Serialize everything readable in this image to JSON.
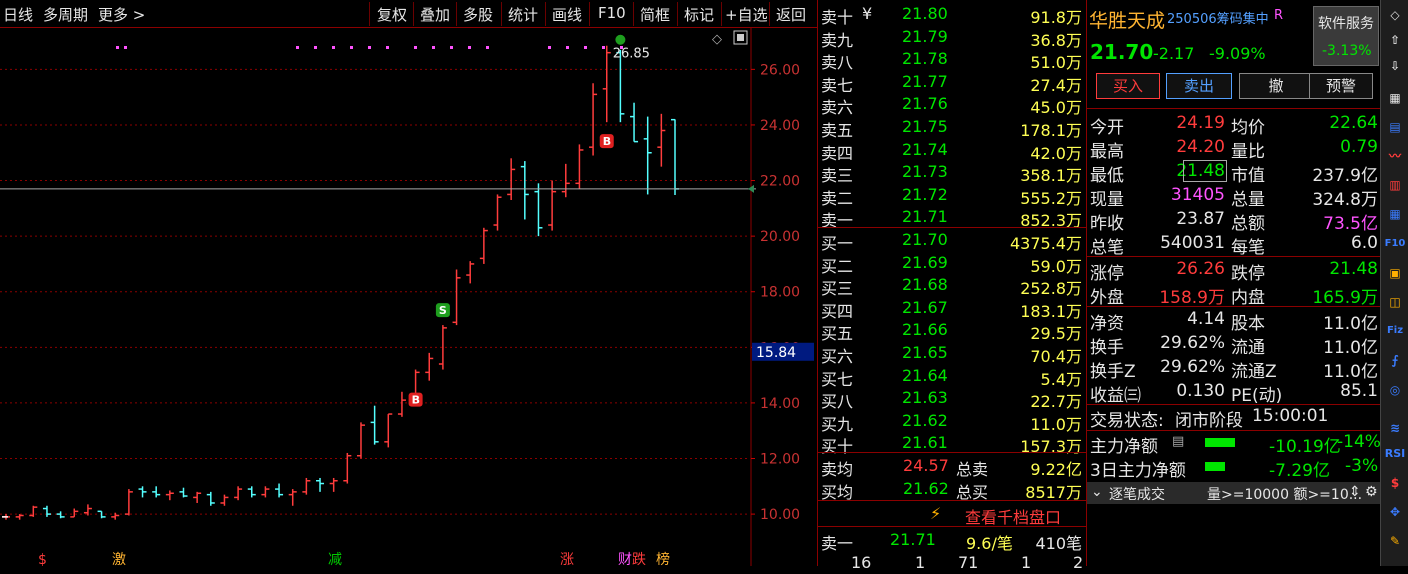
{
  "toolbar": {
    "left": [
      "日线",
      "多周期",
      "更多 >"
    ],
    "right": [
      "复权",
      "叠加",
      "多股",
      "统计",
      "画线",
      "F10",
      "简框",
      "标记",
      "+自选",
      "返回"
    ]
  },
  "chart": {
    "price_axis": [
      "26.00",
      "24.00",
      "22.00",
      "20.00",
      "18.00",
      "16.00",
      "14.00",
      "12.00",
      "10.00"
    ],
    "current_price_tag": "15.84",
    "high_label": "26.85",
    "markers": [
      "B",
      "S",
      "B"
    ],
    "bottom_tags": [
      "$",
      "激",
      "减",
      "涨",
      "财",
      "跌",
      "榜"
    ]
  },
  "chart_data": {
    "type": "ohlc",
    "ylim": [
      9.5,
      27.2
    ],
    "bars": [
      [
        9.9,
        10.0,
        9.8,
        9.9
      ],
      [
        9.9,
        10.0,
        9.8,
        9.95
      ],
      [
        9.95,
        10.3,
        9.9,
        10.25
      ],
      [
        10.2,
        10.3,
        9.9,
        10.0
      ],
      [
        10.0,
        10.1,
        9.85,
        9.9
      ],
      [
        9.9,
        10.2,
        9.9,
        10.1
      ],
      [
        10.05,
        10.35,
        9.95,
        10.2
      ],
      [
        10.1,
        10.1,
        9.85,
        9.9
      ],
      [
        9.9,
        10.05,
        9.8,
        9.95
      ],
      [
        10.0,
        10.9,
        9.95,
        10.8
      ],
      [
        10.9,
        11.0,
        10.6,
        10.8
      ],
      [
        10.8,
        11.0,
        10.6,
        10.7
      ],
      [
        10.7,
        10.85,
        10.5,
        10.75
      ],
      [
        10.8,
        10.95,
        10.6,
        10.65
      ],
      [
        10.6,
        10.8,
        10.4,
        10.75
      ],
      [
        10.7,
        10.8,
        10.3,
        10.4
      ],
      [
        10.4,
        10.7,
        10.3,
        10.6
      ],
      [
        10.6,
        11.0,
        10.5,
        10.9
      ],
      [
        10.9,
        11.0,
        10.6,
        10.7
      ],
      [
        10.7,
        11.0,
        10.6,
        10.9
      ],
      [
        10.9,
        11.1,
        10.6,
        10.7
      ],
      [
        10.7,
        10.9,
        10.3,
        10.8
      ],
      [
        10.8,
        11.3,
        10.7,
        11.2
      ],
      [
        11.2,
        11.3,
        10.8,
        11.1
      ],
      [
        11.1,
        11.3,
        10.8,
        11.2
      ],
      [
        11.2,
        12.2,
        11.1,
        12.1
      ],
      [
        12.1,
        13.3,
        12.0,
        13.2
      ],
      [
        13.3,
        13.9,
        12.5,
        12.6
      ],
      [
        12.6,
        13.6,
        12.4,
        13.6
      ],
      [
        13.6,
        14.4,
        13.5,
        14.1
      ],
      [
        14.2,
        15.2,
        14.0,
        15.1
      ],
      [
        15.1,
        15.8,
        14.8,
        15.6
      ],
      [
        15.4,
        16.8,
        15.2,
        16.7
      ],
      [
        16.9,
        18.8,
        16.8,
        18.5
      ],
      [
        18.6,
        19.1,
        18.3,
        19.0
      ],
      [
        19.2,
        20.3,
        19.0,
        20.2
      ],
      [
        20.4,
        21.5,
        20.2,
        21.4
      ],
      [
        21.5,
        22.8,
        21.3,
        22.4
      ],
      [
        22.5,
        22.7,
        20.6,
        21.5
      ],
      [
        21.6,
        21.9,
        20.0,
        20.3
      ],
      [
        20.4,
        22.0,
        20.2,
        21.6
      ],
      [
        21.6,
        22.6,
        21.4,
        21.9
      ],
      [
        21.9,
        23.3,
        21.7,
        23.1
      ],
      [
        23.2,
        25.5,
        22.9,
        25.1
      ],
      [
        25.3,
        26.85,
        24.1,
        26.6
      ],
      [
        26.6,
        26.7,
        24.1,
        24.4
      ],
      [
        24.3,
        24.8,
        23.4,
        23.4
      ],
      [
        23.5,
        24.3,
        21.5,
        23.0
      ],
      [
        23.2,
        24.4,
        22.5,
        23.8
      ],
      [
        24.19,
        24.2,
        21.48,
        21.7
      ]
    ]
  },
  "order_book": {
    "asks": [
      {
        "label": "卖十",
        "price": "21.80",
        "vol": "91.8万"
      },
      {
        "label": "卖九",
        "price": "21.79",
        "vol": "36.8万"
      },
      {
        "label": "卖八",
        "price": "21.78",
        "vol": "51.0万"
      },
      {
        "label": "卖七",
        "price": "21.77",
        "vol": "27.4万"
      },
      {
        "label": "卖六",
        "price": "21.76",
        "vol": "45.0万"
      },
      {
        "label": "卖五",
        "price": "21.75",
        "vol": "178.1万"
      },
      {
        "label": "卖四",
        "price": "21.74",
        "vol": "42.0万"
      },
      {
        "label": "卖三",
        "price": "21.73",
        "vol": "358.1万"
      },
      {
        "label": "卖二",
        "price": "21.72",
        "vol": "555.2万"
      },
      {
        "label": "卖一",
        "price": "21.71",
        "vol": "852.3万"
      }
    ],
    "bids": [
      {
        "label": "买一",
        "price": "21.70",
        "vol": "4375.4万"
      },
      {
        "label": "买二",
        "price": "21.69",
        "vol": "59.0万"
      },
      {
        "label": "买三",
        "price": "21.68",
        "vol": "252.8万"
      },
      {
        "label": "买四",
        "price": "21.67",
        "vol": "183.1万"
      },
      {
        "label": "买五",
        "price": "21.66",
        "vol": "29.5万"
      },
      {
        "label": "买六",
        "price": "21.65",
        "vol": "70.4万"
      },
      {
        "label": "买七",
        "price": "21.64",
        "vol": "5.4万"
      },
      {
        "label": "买八",
        "price": "21.63",
        "vol": "22.7万"
      },
      {
        "label": "买九",
        "price": "21.62",
        "vol": "11.0万"
      },
      {
        "label": "买十",
        "price": "21.61",
        "vol": "157.3万"
      }
    ],
    "ask_sign": "¥",
    "avg": {
      "sell_avg_label": "卖均",
      "sell_avg": "24.57",
      "total_sell_label": "总卖",
      "total_sell": "9.22亿",
      "buy_avg_label": "买均",
      "buy_avg": "21.62",
      "total_buy_label": "总买",
      "total_buy": "8517万"
    },
    "depth_link": "查看千档盘口",
    "tick": {
      "label": "卖一",
      "price": "21.71",
      "vol": "9.6/笔",
      "count": "410笔"
    },
    "bottom_nums": [
      "16",
      "1",
      "71",
      "1",
      "2"
    ]
  },
  "quote": {
    "name": "华胜天成",
    "tag": "250506筹码集中",
    "tag_suffix": "R",
    "price": "21.70",
    "change": "-2.17",
    "pct": "-9.09%",
    "service_label": "软件服务",
    "service_pct": "-3.13%",
    "buttons": [
      "买入",
      "卖出",
      "撤",
      "预警"
    ],
    "stats": [
      [
        "今开",
        "24.19",
        "均价",
        "22.64"
      ],
      [
        "最高",
        "24.20",
        "量比",
        "0.79"
      ],
      [
        "最低",
        "21.48",
        "市值",
        "237.9亿"
      ],
      [
        "现量",
        "31405",
        "总量",
        "324.8万"
      ],
      [
        "昨收",
        "23.87",
        "总额",
        "73.5亿"
      ],
      [
        "总笔",
        "540031",
        "每笔",
        "6.0"
      ],
      [
        "涨停",
        "26.26",
        "跌停",
        "21.48"
      ],
      [
        "外盘",
        "158.9万",
        "内盘",
        "165.9万"
      ],
      [
        "净资",
        "4.14",
        "股本",
        "11.0亿"
      ],
      [
        "换手",
        "29.62%",
        "流通",
        "11.0亿"
      ],
      [
        "换手Z",
        "29.62%",
        "流通Z",
        "11.0亿"
      ],
      [
        "收益㈢",
        "0.130",
        "PE(动)",
        "85.1"
      ]
    ],
    "trade_status_label": "交易状态:",
    "trade_status": "闭市阶段",
    "trade_time": "15:00:01",
    "main_net_label": "主力净额",
    "main_net": "-10.19亿",
    "main_net_pct": "-14%",
    "main_net3_label": "3日主力净额",
    "main_net3": "-7.29亿",
    "main_net3_pct": "-3%",
    "tick_filter": "逐笔成交",
    "tick_filter_opts": "量>=10000 额>=10..."
  },
  "sidebar": [
    "F10",
    "F10",
    "Fiz",
    "RSI",
    "$"
  ],
  "colors": {
    "up": "#ff3c3c",
    "down": "#54ffff",
    "accent": "#8b0000"
  }
}
